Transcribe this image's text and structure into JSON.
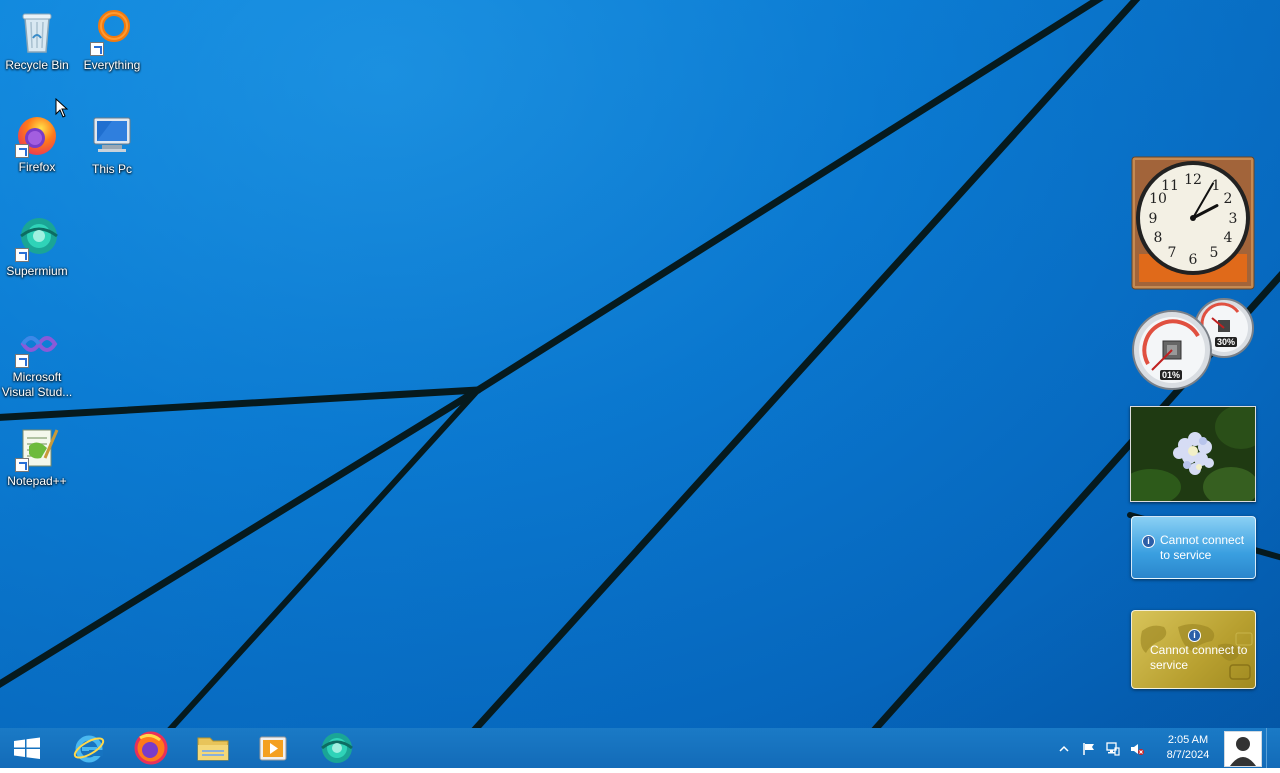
{
  "desktop": {
    "icons": [
      {
        "label": "Recycle Bin",
        "icon": "recycle-bin-icon"
      },
      {
        "label": "Everything",
        "icon": "everything-search-icon"
      },
      {
        "label": "Firefox",
        "icon": "firefox-icon"
      },
      {
        "label": "This Pc",
        "icon": "this-pc-icon"
      },
      {
        "label": "Supermium",
        "icon": "supermium-icon"
      },
      {
        "label": "Microsoft Visual Stud...",
        "icon": "visual-studio-icon"
      },
      {
        "label": "Notepad++",
        "icon": "notepadpp-icon"
      }
    ]
  },
  "gadgets": {
    "clock": {
      "hour": 2,
      "minute": 5
    },
    "cpu_meter": {
      "cpu": "01%",
      "memory": "30%"
    },
    "slideshow": {
      "subject": "hydrangea flower photo"
    },
    "weather": {
      "message": "Cannot connect to service"
    },
    "currency": {
      "message": "Cannot connect to service"
    }
  },
  "taskbar": {
    "pinned": [
      {
        "name": "start",
        "icon": "windows-logo-icon"
      },
      {
        "name": "internet-explorer",
        "icon": "internet-explorer-icon"
      },
      {
        "name": "firefox",
        "icon": "firefox-icon"
      },
      {
        "name": "file-explorer",
        "icon": "file-explorer-icon"
      },
      {
        "name": "media-player",
        "icon": "media-player-icon"
      },
      {
        "name": "supermium",
        "icon": "supermium-icon"
      }
    ],
    "clock": {
      "time": "2:05 AM",
      "date": "8/7/2024"
    }
  },
  "colors": {
    "desktop_blue": "#0a78d2",
    "taskbar_blue": "#1673c0",
    "wallpaper_lines": "#061a1e"
  }
}
